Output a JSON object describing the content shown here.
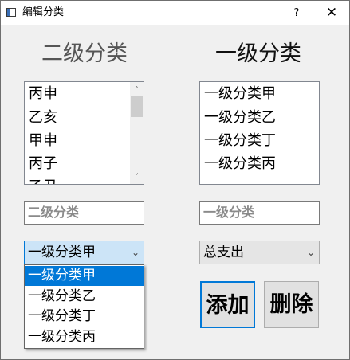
{
  "window": {
    "title": "编辑分类",
    "help_label": "?",
    "close_label": "✕"
  },
  "headings": {
    "secondary": "二级分类",
    "primary": "一级分类"
  },
  "secondary_list": {
    "items": [
      "丙申",
      "乙亥",
      "甲申",
      "丙子",
      "乙丑"
    ],
    "scroll_up": "˄",
    "scroll_down": "˅"
  },
  "primary_list": {
    "items": [
      "一级分类甲",
      "一级分类乙",
      "一级分类丁",
      "一级分类丙"
    ]
  },
  "inputs": {
    "secondary_name": "二级分类",
    "primary_name": "一级分类"
  },
  "parent_combo": {
    "selected": "一级分类甲",
    "chevron": "⌄",
    "options": [
      "一级分类甲",
      "一级分类乙",
      "一级分类丁",
      "一级分类丙"
    ]
  },
  "type_combo": {
    "selected": "总支出",
    "chevron": "⌄"
  },
  "buttons": {
    "add": "添加",
    "delete": "删除"
  }
}
